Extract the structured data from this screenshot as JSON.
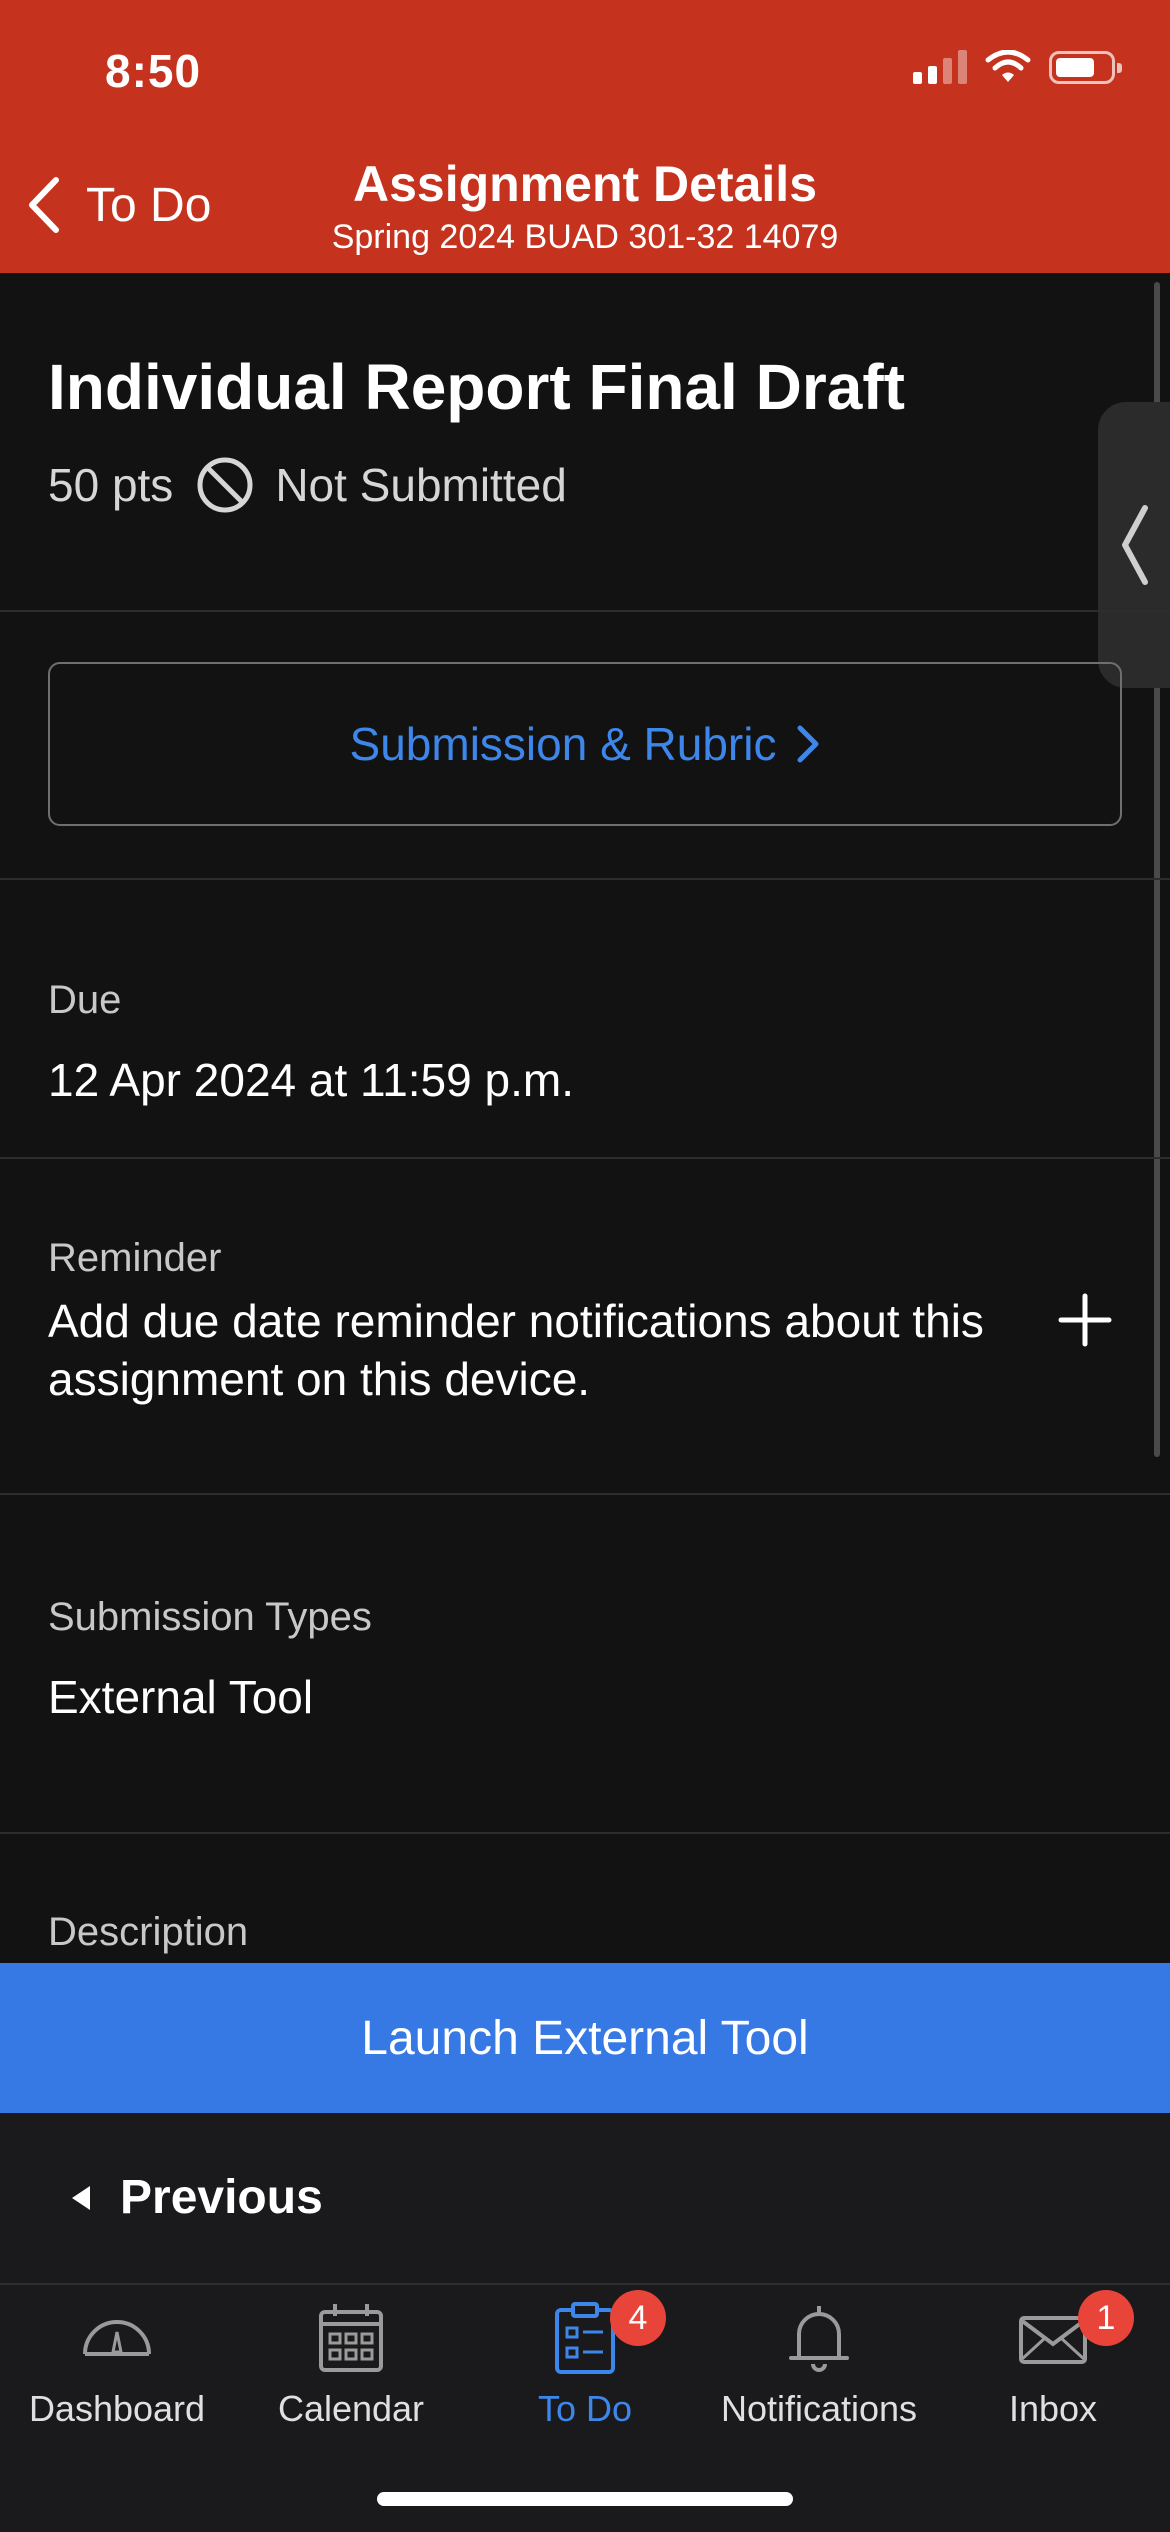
{
  "status_bar": {
    "time": "8:50"
  },
  "header": {
    "back_label": "To Do",
    "title": "Assignment Details",
    "subtitle": "Spring 2024 BUAD 301-32 14079"
  },
  "assignment": {
    "title": "Individual Report Final Draft",
    "points": "50 pts",
    "status": "Not Submitted",
    "submission_button": "Submission & Rubric"
  },
  "due": {
    "label": "Due",
    "value": "12 Apr 2024 at 11:59 p.m."
  },
  "reminder": {
    "label": "Reminder",
    "text": "Add due date reminder notifications about this assignment on this device."
  },
  "submission_types": {
    "label": "Submission Types",
    "value": "External Tool"
  },
  "description": {
    "label": "Description"
  },
  "actions": {
    "launch": "Launch External Tool",
    "previous": "Previous"
  },
  "tabbar": {
    "items": [
      {
        "label": "Dashboard",
        "icon": "dashboard-gauge-icon"
      },
      {
        "label": "Calendar",
        "icon": "calendar-icon"
      },
      {
        "label": "To Do",
        "icon": "todo-clipboard-icon",
        "badge": "4",
        "active": true
      },
      {
        "label": "Notifications",
        "icon": "bell-icon"
      },
      {
        "label": "Inbox",
        "icon": "envelope-icon",
        "badge": "1"
      }
    ]
  },
  "colors": {
    "header": "#c5321e",
    "accent": "#3678e4",
    "link": "#3d86ea",
    "badge": "#e9443a",
    "background": "#121212"
  }
}
